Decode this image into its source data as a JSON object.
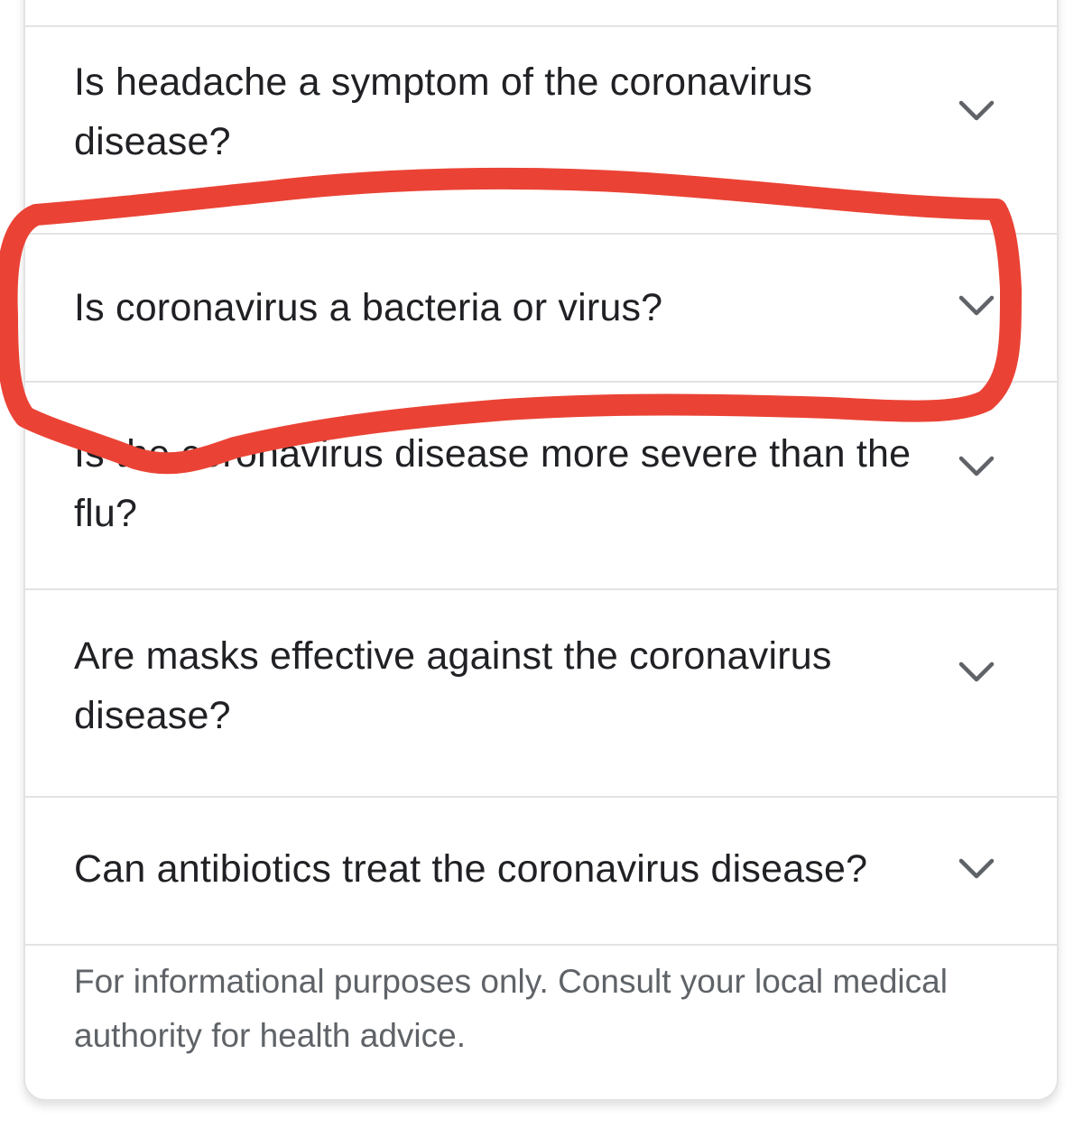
{
  "faq": {
    "items": [
      {
        "question": "Is headache a symptom of the coronavirus disease?",
        "icon": "chevron-down-icon"
      },
      {
        "question": "Is coronavirus a bacteria or virus?",
        "icon": "chevron-down-icon"
      },
      {
        "question": "Is the coronavirus disease more severe than the flu?",
        "icon": "chevron-down-icon"
      },
      {
        "question": "Are masks effective against the coronavirus disease?",
        "icon": "chevron-down-icon"
      },
      {
        "question": "Can antibiotics treat the coronavirus disease?",
        "icon": "chevron-down-icon"
      }
    ]
  },
  "footer": {
    "disclaimer": "For informational purposes only. Consult your local medical authority for health advice."
  },
  "colors": {
    "annotation": "#ea4335",
    "text": "#202124",
    "secondary_text": "#5f6368",
    "divider": "#e3e3e3"
  }
}
